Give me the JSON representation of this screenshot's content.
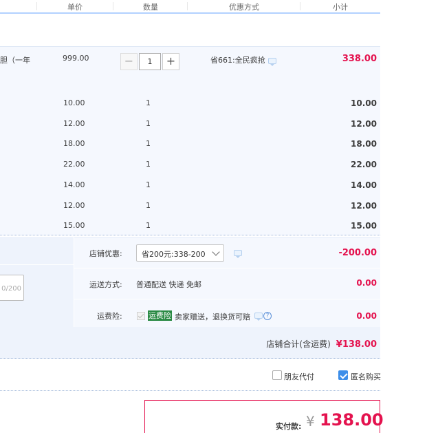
{
  "header": {
    "columns": [
      "单价",
      "数量",
      "优惠方式",
      "小计"
    ]
  },
  "main_item": {
    "name_fragment": "胆（一年",
    "price": "999.00",
    "quantity": "1",
    "discount": "省661:全民疯抢",
    "subtotal": "338.00"
  },
  "sub_items": [
    {
      "price": "10.00",
      "quantity": "1",
      "subtotal": "10.00"
    },
    {
      "price": "12.00",
      "quantity": "1",
      "subtotal": "12.00"
    },
    {
      "price": "18.00",
      "quantity": "1",
      "subtotal": "18.00"
    },
    {
      "price": "22.00",
      "quantity": "1",
      "subtotal": "22.00"
    },
    {
      "price": "14.00",
      "quantity": "1",
      "subtotal": "14.00"
    },
    {
      "price": "12.00",
      "quantity": "1",
      "subtotal": "12.00"
    },
    {
      "price": "15.00",
      "quantity": "1",
      "subtotal": "15.00"
    }
  ],
  "shop": {
    "promo_label": "店铺优惠:",
    "promo_selected": "省200元:338-200",
    "promo_amount": "-200.00",
    "shipping_label": "运送方式:",
    "shipping_value": "普通配送 快递 免邮",
    "shipping_amount": "0.00",
    "insurance_label": "运费险:",
    "insurance_tag": "运费险",
    "insurance_desc": "卖家赠送，退换货可赔",
    "insurance_amount": "0.00",
    "message_counter": "0/200",
    "total_label": "店铺合计(含运费)",
    "total_value": "¥138.00"
  },
  "options": {
    "friend_pay": "朋友代付",
    "anonymous": "匿名购买",
    "anonymous_checked": true,
    "friend_pay_checked": false
  },
  "payment": {
    "label": "实付款:",
    "currency": "¥",
    "value": "138.00"
  },
  "colors": {
    "price_red": "#e4124e",
    "accent_blue": "#3d8ee9",
    "panel_bg": "#f5f8fe"
  }
}
